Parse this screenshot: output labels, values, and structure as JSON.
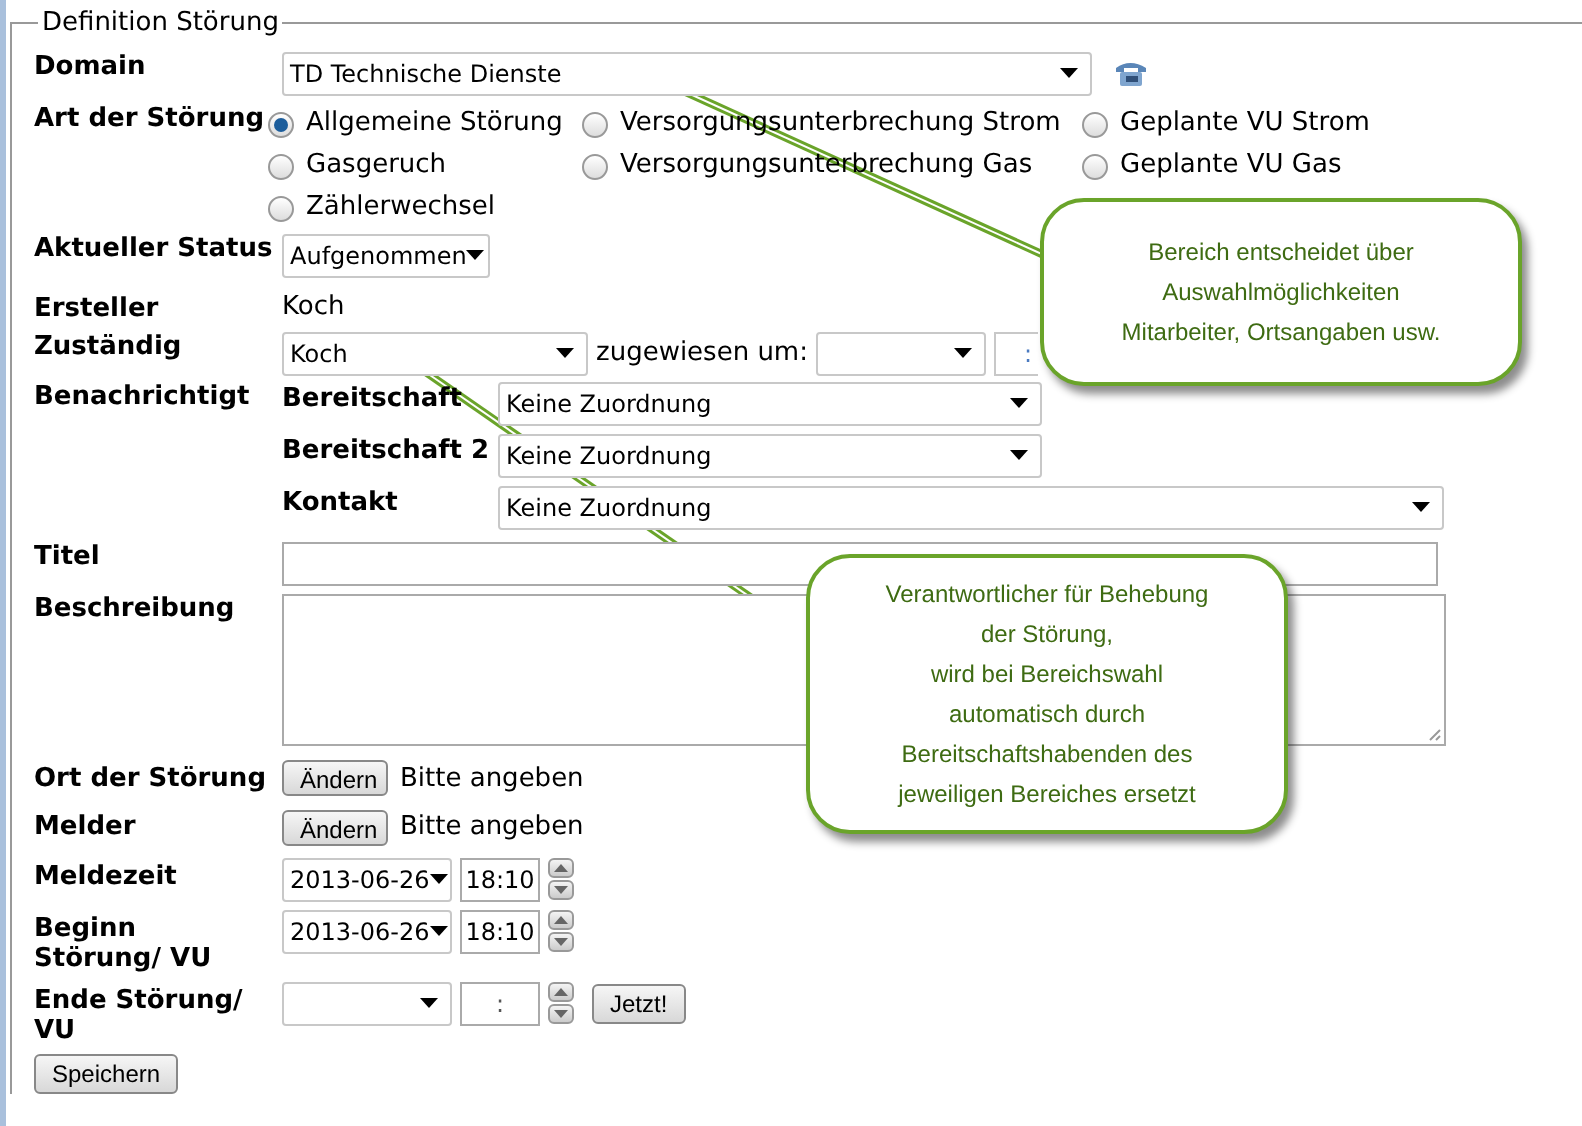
{
  "legend": "Definition Störung",
  "domain": {
    "label": "Domain",
    "value": "TD Technische Dienste"
  },
  "art": {
    "label": "Art der Störung",
    "options": [
      {
        "label": "Allgemeine Störung",
        "selected": true
      },
      {
        "label": "Versorgungsunterbrechung Strom",
        "selected": false
      },
      {
        "label": "Geplante VU Strom",
        "selected": false
      },
      {
        "label": "Gasgeruch",
        "selected": false
      },
      {
        "label": "Versorgungsunterbrechung Gas",
        "selected": false
      },
      {
        "label": "Geplante VU Gas",
        "selected": false
      },
      {
        "label": "Zählerwechsel",
        "selected": false
      }
    ]
  },
  "status": {
    "label": "Aktueller Status",
    "value": "Aufgenommen"
  },
  "ersteller": {
    "label": "Ersteller",
    "value": "Koch"
  },
  "zustaendig": {
    "label": "Zuständig",
    "value": "Koch",
    "assigned_label": "zugewiesen um:",
    "time": ":"
  },
  "benachrichtigt": {
    "label": "Benachrichtigt",
    "rows": [
      {
        "label": "Bereitschaft",
        "value": "Keine Zuordnung",
        "wide": false
      },
      {
        "label": "Bereitschaft 2",
        "value": "Keine Zuordnung",
        "wide": false
      },
      {
        "label": "Kontakt",
        "value": "Keine Zuordnung",
        "wide": true
      }
    ]
  },
  "titel": {
    "label": "Titel"
  },
  "beschreibung": {
    "label": "Beschreibung"
  },
  "pickers": [
    {
      "label": "Ort der Störung",
      "button": "Ändern",
      "value": "Bitte angeben"
    },
    {
      "label": "Melder",
      "button": "Ändern",
      "value": "Bitte angeben"
    }
  ],
  "times": [
    {
      "label": "Meldezeit",
      "date": "2013-06-26",
      "time": "18:10"
    },
    {
      "label": "Beginn Störung/ VU",
      "date": "2013-06-26",
      "time": "18:10"
    },
    {
      "label": "Ende Störung/ VU",
      "time": ":",
      "now_button": "Jetzt!"
    }
  ],
  "save_button": "Speichern",
  "callouts": [
    {
      "lines": [
        "Bereich entscheidet über",
        "Auswahlmöglichkeiten",
        "Mitarbeiter, Ortsangaben usw."
      ]
    },
    {
      "lines": [
        "Verantwortlicher für Behebung",
        "der Störung,",
        "wird bei Bereichswahl",
        "automatisch durch",
        "Bereitschaftshabenden des",
        "jeweiligen Bereiches ersetzt"
      ]
    }
  ]
}
